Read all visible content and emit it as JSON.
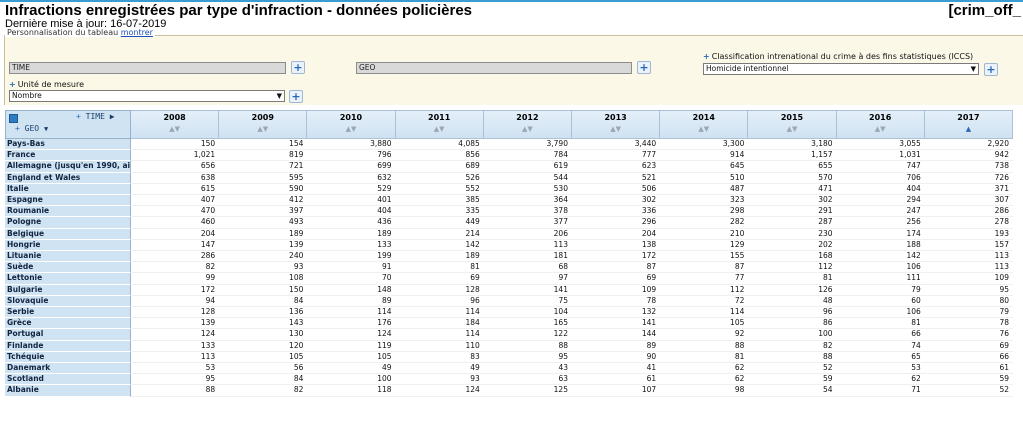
{
  "header": {
    "title": "Infractions enregistrées par type d'infraction - données policières",
    "code": "[crim_off_",
    "updated": "Dernière mise à jour: 16-07-2019"
  },
  "customize": {
    "label": "Personnalisation du tableau",
    "link": "montrer"
  },
  "filters": {
    "time_box": "TIME",
    "geo_box": "GEO",
    "iccs_label": "Classification intrenational du crime à des fins statistiques (ICCS)",
    "iccs_value": "Homicide intentionnel",
    "unit_label": "Unité de mesure",
    "unit_value": "Nombre",
    "plus": "+",
    "dropdown": "▼"
  },
  "table": {
    "time_label": "TIME",
    "geo_label": "GEO",
    "time_arrow": "▶",
    "geo_arrow": "▼",
    "sort_neutral": "▲▼",
    "sort_active": "▲",
    "years": [
      "2008",
      "2009",
      "2010",
      "2011",
      "2012",
      "2013",
      "2014",
      "2015",
      "2016",
      "2017"
    ],
    "rows": [
      {
        "geo": "Pays-Bas",
        "values": [
          "150",
          "154",
          "3,880",
          "4,085",
          "3,790",
          "3,440",
          "3,300",
          "3,180",
          "3,055",
          "2,920"
        ]
      },
      {
        "geo": "France",
        "values": [
          "1,021",
          "819",
          "796",
          "856",
          "784",
          "777",
          "914",
          "1,157",
          "1,031",
          "942"
        ]
      },
      {
        "geo": "Allemagne (jusqu'en 1990, ai",
        "values": [
          "656",
          "721",
          "699",
          "689",
          "619",
          "623",
          "645",
          "655",
          "747",
          "738"
        ]
      },
      {
        "geo": "England et Wales",
        "values": [
          "638",
          "595",
          "632",
          "526",
          "544",
          "521",
          "510",
          "570",
          "706",
          "726"
        ]
      },
      {
        "geo": "Italie",
        "values": [
          "615",
          "590",
          "529",
          "552",
          "530",
          "506",
          "487",
          "471",
          "404",
          "371"
        ]
      },
      {
        "geo": "Espagne",
        "values": [
          "407",
          "412",
          "401",
          "385",
          "364",
          "302",
          "323",
          "302",
          "294",
          "307"
        ]
      },
      {
        "geo": "Roumanie",
        "values": [
          "470",
          "397",
          "404",
          "335",
          "378",
          "336",
          "298",
          "291",
          "247",
          "286"
        ]
      },
      {
        "geo": "Pologne",
        "values": [
          "460",
          "493",
          "436",
          "449",
          "377",
          "296",
          "282",
          "287",
          "256",
          "278"
        ]
      },
      {
        "geo": "Belgique",
        "values": [
          "204",
          "189",
          "189",
          "214",
          "206",
          "204",
          "210",
          "230",
          "174",
          "193"
        ]
      },
      {
        "geo": "Hongrie",
        "values": [
          "147",
          "139",
          "133",
          "142",
          "113",
          "138",
          "129",
          "202",
          "188",
          "157"
        ]
      },
      {
        "geo": "Lituanie",
        "values": [
          "286",
          "240",
          "199",
          "189",
          "181",
          "172",
          "155",
          "168",
          "142",
          "113"
        ]
      },
      {
        "geo": "Suède",
        "values": [
          "82",
          "93",
          "91",
          "81",
          "68",
          "87",
          "87",
          "112",
          "106",
          "113"
        ]
      },
      {
        "geo": "Lettonie",
        "values": [
          "99",
          "108",
          "70",
          "69",
          "97",
          "69",
          "77",
          "81",
          "111",
          "109"
        ]
      },
      {
        "geo": "Bulgarie",
        "values": [
          "172",
          "150",
          "148",
          "128",
          "141",
          "109",
          "112",
          "126",
          "79",
          "95"
        ]
      },
      {
        "geo": "Slovaquie",
        "values": [
          "94",
          "84",
          "89",
          "96",
          "75",
          "78",
          "72",
          "48",
          "60",
          "80"
        ]
      },
      {
        "geo": "Serbie",
        "values": [
          "128",
          "136",
          "114",
          "114",
          "104",
          "132",
          "114",
          "96",
          "106",
          "79"
        ]
      },
      {
        "geo": "Grèce",
        "values": [
          "139",
          "143",
          "176",
          "184",
          "165",
          "141",
          "105",
          "86",
          "81",
          "78"
        ]
      },
      {
        "geo": "Portugal",
        "values": [
          "124",
          "130",
          "124",
          "114",
          "122",
          "144",
          "92",
          "100",
          "66",
          "76"
        ]
      },
      {
        "geo": "Finlande",
        "values": [
          "133",
          "120",
          "119",
          "110",
          "88",
          "89",
          "88",
          "82",
          "74",
          "69"
        ]
      },
      {
        "geo": "Tchéquie",
        "values": [
          "113",
          "105",
          "105",
          "83",
          "95",
          "90",
          "81",
          "88",
          "65",
          "66"
        ]
      },
      {
        "geo": "Danemark",
        "values": [
          "53",
          "56",
          "49",
          "49",
          "43",
          "41",
          "62",
          "52",
          "53",
          "61"
        ]
      },
      {
        "geo": "Scotland",
        "values": [
          "95",
          "84",
          "100",
          "93",
          "63",
          "61",
          "62",
          "59",
          "62",
          "59"
        ]
      },
      {
        "geo": "Albanie",
        "values": [
          "88",
          "82",
          "118",
          "124",
          "125",
          "107",
          "98",
          "54",
          "71",
          "52"
        ]
      }
    ]
  }
}
